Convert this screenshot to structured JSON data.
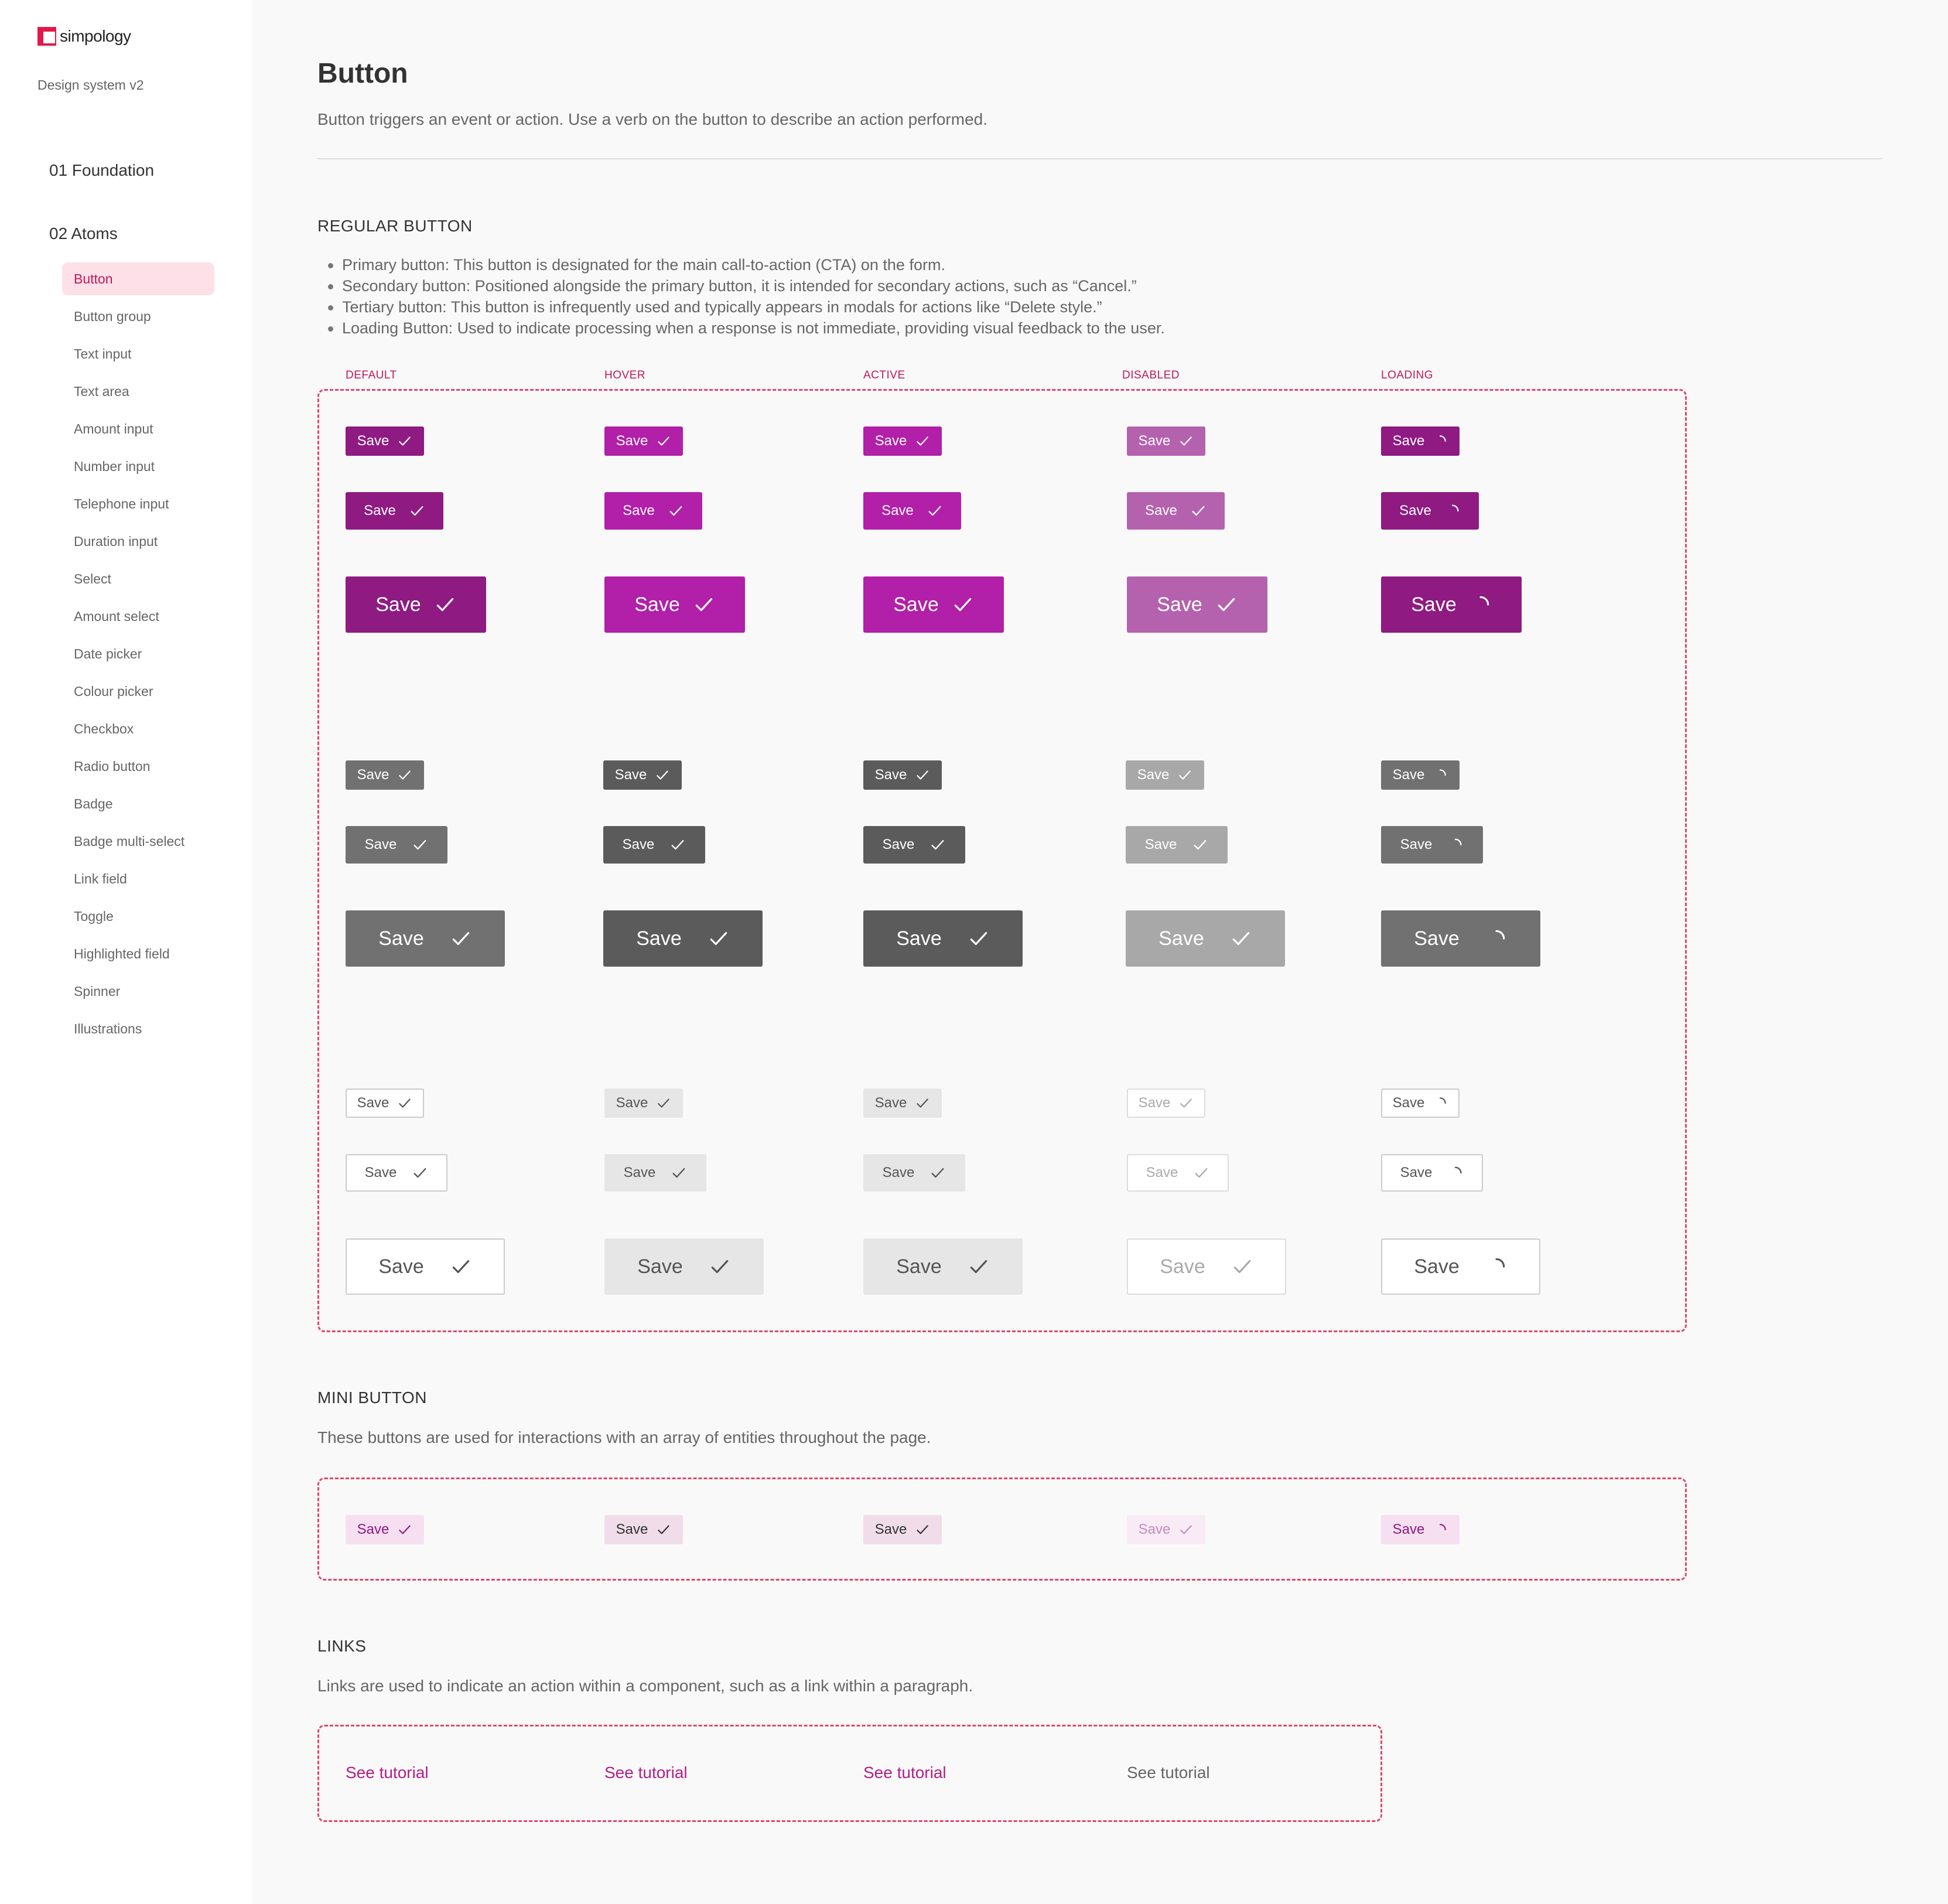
{
  "sidebar": {
    "brand": "simpology",
    "version": "Design system v2",
    "sections": [
      "01 Foundation",
      "02 Atoms"
    ],
    "items": [
      {
        "label": "Button",
        "active": true
      },
      {
        "label": "Button group"
      },
      {
        "label": "Text input"
      },
      {
        "label": "Text area"
      },
      {
        "label": "Amount input"
      },
      {
        "label": "Number input"
      },
      {
        "label": "Telephone input"
      },
      {
        "label": "Duration input"
      },
      {
        "label": "Select"
      },
      {
        "label": "Amount select"
      },
      {
        "label": "Date picker"
      },
      {
        "label": "Colour picker"
      },
      {
        "label": "Checkbox"
      },
      {
        "label": "Radio button"
      },
      {
        "label": "Badge"
      },
      {
        "label": "Badge multi-select"
      },
      {
        "label": "Link field"
      },
      {
        "label": "Toggle"
      },
      {
        "label": "Highlighted field"
      },
      {
        "label": "Spinner"
      },
      {
        "label": "Illustrations"
      }
    ]
  },
  "page": {
    "title": "Button",
    "description": "Button triggers an event or action. Use a verb on the button to describe an action performed."
  },
  "regular": {
    "title": "REGULAR BUTTON",
    "bullets": [
      "Primary button: This button is designated for the main call-to-action (CTA) on the form.",
      "Secondary button: Positioned alongside the primary button, it is intended for secondary actions, such as “Cancel.”",
      "Tertiary button: This button is infrequently used and typically appears in modals for actions like “Delete style.”",
      "Loading Button: Used to indicate processing when a response is not immediate, providing visual feedback to the user."
    ],
    "states": [
      "DEFAULT",
      "HOVER",
      "ACTIVE",
      "DISABLED",
      "LOADING"
    ],
    "button_label": "Save"
  },
  "mini": {
    "title": "MINI BUTTON",
    "description": "These buttons are used for interactions with an array of entities throughout the page.",
    "button_label": "Save"
  },
  "links": {
    "title": "LINKS",
    "description": "Links are used to indicate an action within a component, such as a link within a paragraph.",
    "items": [
      "See tutorial",
      "See tutorial",
      "See tutorial",
      "See tutorial"
    ]
  },
  "colors": {
    "accent": "#e0456e",
    "primary": "#8e1a82",
    "primary_hover": "#b21fa8",
    "secondary": "#717171",
    "secondary_hover": "#5b5b5b"
  }
}
